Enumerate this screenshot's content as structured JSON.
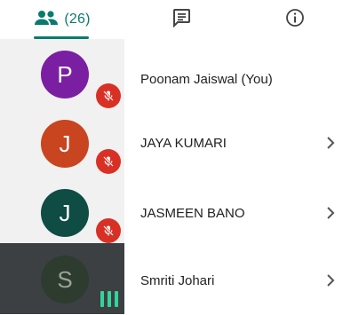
{
  "tabs": {
    "people_count": "(26)"
  },
  "participants": [
    {
      "initial": "P",
      "name": "Poonam Jaiswal (You)",
      "avatar_color": "#7b1fa2",
      "muted": true,
      "speaking": false,
      "has_chevron": false
    },
    {
      "initial": "J",
      "name": "JAYA KUMARI",
      "avatar_color": "#c8451f",
      "muted": true,
      "speaking": false,
      "has_chevron": true
    },
    {
      "initial": "J",
      "name": "JASMEEN BANO",
      "avatar_color": "#0f4c43",
      "muted": true,
      "speaking": false,
      "has_chevron": true
    },
    {
      "initial": "S",
      "name": "Smriti Johari",
      "avatar_color": "#2e3b2f",
      "muted": false,
      "speaking": true,
      "has_chevron": true
    }
  ],
  "colors": {
    "accent": "#0b7a6e",
    "mute_red": "#d93025",
    "speaking_green": "#34d399"
  }
}
